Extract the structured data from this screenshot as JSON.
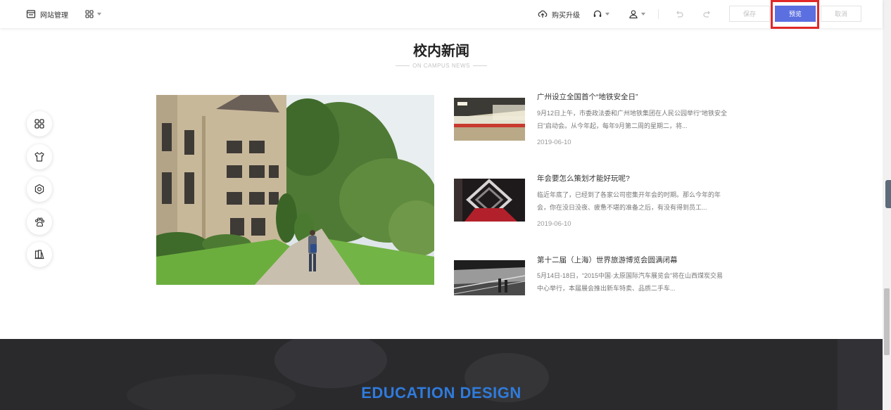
{
  "topbar": {
    "site_manage_label": "网站管理",
    "buy_upgrade_label": "购买升级",
    "save_label": "保存",
    "preview_label": "预览",
    "cancel_label": "取消"
  },
  "section": {
    "title": "校内新闻",
    "subtitle": "ON CAMPUS NEWS"
  },
  "news": [
    {
      "title": "广州设立全国首个“地铁安全日”",
      "desc": "9月12日上午，市委政法委和广州地铁集团在人民公园举行“地铁安全日”启动会。从今年起，每年9月第二周的星期二，将...",
      "date": "2019-06-10"
    },
    {
      "title": "年会要怎么策划才能好玩呢?",
      "desc": "临近年底了，已经到了各家公司密集开年会的时期。那么今年的年会，你在没日没夜、疲惫不堪的准备之后，有没有得到员工...",
      "date": "2019-06-10"
    },
    {
      "title": "第十二届（上海）世界旅游博览会圆满闭幕",
      "desc": "5月14日-18日，“2015中国·太原国际汽车展览会”将在山西煤炭交易中心举行，本届展会推出新车特卖、品质二手车...",
      "date": ""
    }
  ],
  "banner": {
    "title": "EDUCATION DESIGN"
  },
  "colors": {
    "primary": "#5b6fe0",
    "highlight": "#e12828",
    "banner_title": "#2f7bdc"
  },
  "icons": [
    "layout-icon",
    "apps-grid-icon",
    "cloud-upload-icon",
    "headset-icon",
    "user-icon",
    "undo-icon",
    "redo-icon",
    "shirt-icon",
    "settings-icon",
    "paw-icon",
    "books-icon"
  ]
}
